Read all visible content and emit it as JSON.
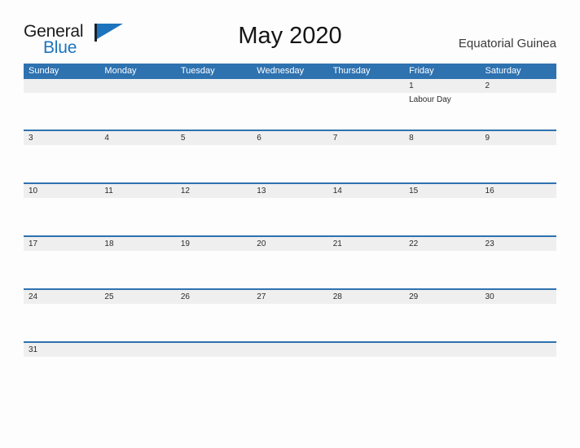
{
  "logo": {
    "word_one": "General",
    "word_two": "Blue",
    "mark": "triangle-flag-mark"
  },
  "header": {
    "title": "May 2020",
    "country": "Equatorial Guinea"
  },
  "calendar": {
    "weekday_headers": [
      "Sunday",
      "Monday",
      "Tuesday",
      "Wednesday",
      "Thursday",
      "Friday",
      "Saturday"
    ],
    "colors": {
      "header_blue": "#2e72b0",
      "date_band_gray": "#efefef",
      "row_rule_blue": "#2e72b0",
      "logo_blue": "#1d74bd",
      "page_background": "#fdfdfd"
    },
    "weeks": [
      {
        "days": [
          {
            "num": "",
            "event": ""
          },
          {
            "num": "",
            "event": ""
          },
          {
            "num": "",
            "event": ""
          },
          {
            "num": "",
            "event": ""
          },
          {
            "num": "",
            "event": ""
          },
          {
            "num": "1",
            "event": "Labour Day"
          },
          {
            "num": "2",
            "event": ""
          }
        ]
      },
      {
        "days": [
          {
            "num": "3",
            "event": ""
          },
          {
            "num": "4",
            "event": ""
          },
          {
            "num": "5",
            "event": ""
          },
          {
            "num": "6",
            "event": ""
          },
          {
            "num": "7",
            "event": ""
          },
          {
            "num": "8",
            "event": ""
          },
          {
            "num": "9",
            "event": ""
          }
        ]
      },
      {
        "days": [
          {
            "num": "10",
            "event": ""
          },
          {
            "num": "11",
            "event": ""
          },
          {
            "num": "12",
            "event": ""
          },
          {
            "num": "13",
            "event": ""
          },
          {
            "num": "14",
            "event": ""
          },
          {
            "num": "15",
            "event": ""
          },
          {
            "num": "16",
            "event": ""
          }
        ]
      },
      {
        "days": [
          {
            "num": "17",
            "event": ""
          },
          {
            "num": "18",
            "event": ""
          },
          {
            "num": "19",
            "event": ""
          },
          {
            "num": "20",
            "event": ""
          },
          {
            "num": "21",
            "event": ""
          },
          {
            "num": "22",
            "event": ""
          },
          {
            "num": "23",
            "event": ""
          }
        ]
      },
      {
        "days": [
          {
            "num": "24",
            "event": ""
          },
          {
            "num": "25",
            "event": ""
          },
          {
            "num": "26",
            "event": ""
          },
          {
            "num": "27",
            "event": ""
          },
          {
            "num": "28",
            "event": ""
          },
          {
            "num": "29",
            "event": ""
          },
          {
            "num": "30",
            "event": ""
          }
        ]
      },
      {
        "days": [
          {
            "num": "31",
            "event": ""
          },
          {
            "num": "",
            "event": ""
          },
          {
            "num": "",
            "event": ""
          },
          {
            "num": "",
            "event": ""
          },
          {
            "num": "",
            "event": ""
          },
          {
            "num": "",
            "event": ""
          },
          {
            "num": "",
            "event": ""
          }
        ]
      }
    ]
  }
}
